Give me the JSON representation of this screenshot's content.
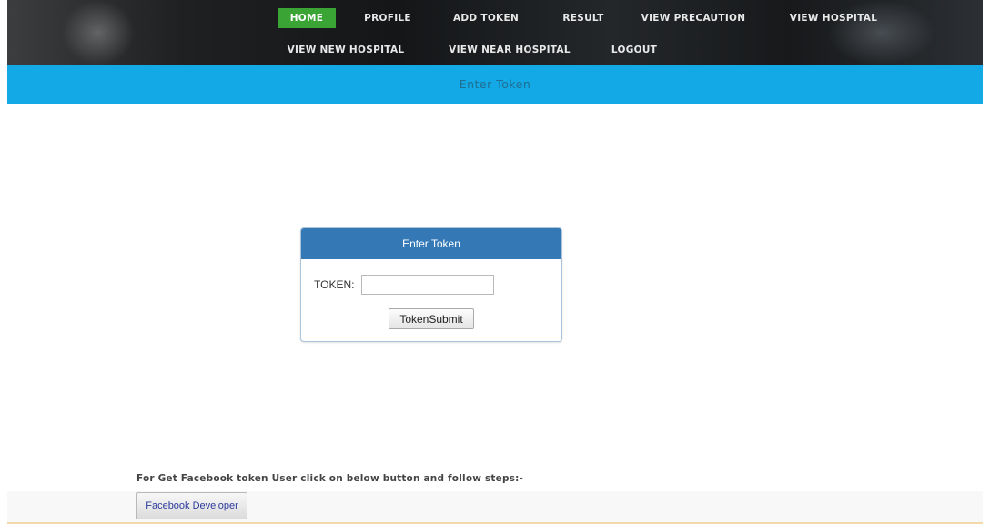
{
  "nav": {
    "items": [
      {
        "label": "HOME",
        "active": true
      },
      {
        "label": "PROFILE"
      },
      {
        "label": "ADD TOKEN"
      },
      {
        "label": "RESULT"
      },
      {
        "label": "VIEW PRECAUTION"
      },
      {
        "label": "VIEW HOSPITAL"
      },
      {
        "label": "VIEW NEW HOSPITAL"
      },
      {
        "label": "VIEW NEAR HOSPITAL"
      },
      {
        "label": "LOGOUT"
      }
    ],
    "active_color": "#3aa535"
  },
  "subheader": {
    "title": "Enter Token",
    "background_color": "#13a8e6"
  },
  "token_panel": {
    "heading": "Enter Token",
    "field_label": "TOKEN:",
    "input_value": "",
    "submit_label": "TokenSubmit",
    "heading_color": "#3478b6"
  },
  "footer": {
    "instructions": "For Get Facebook token User click on below button and follow steps:-",
    "button_label": "Facebook Developer"
  }
}
